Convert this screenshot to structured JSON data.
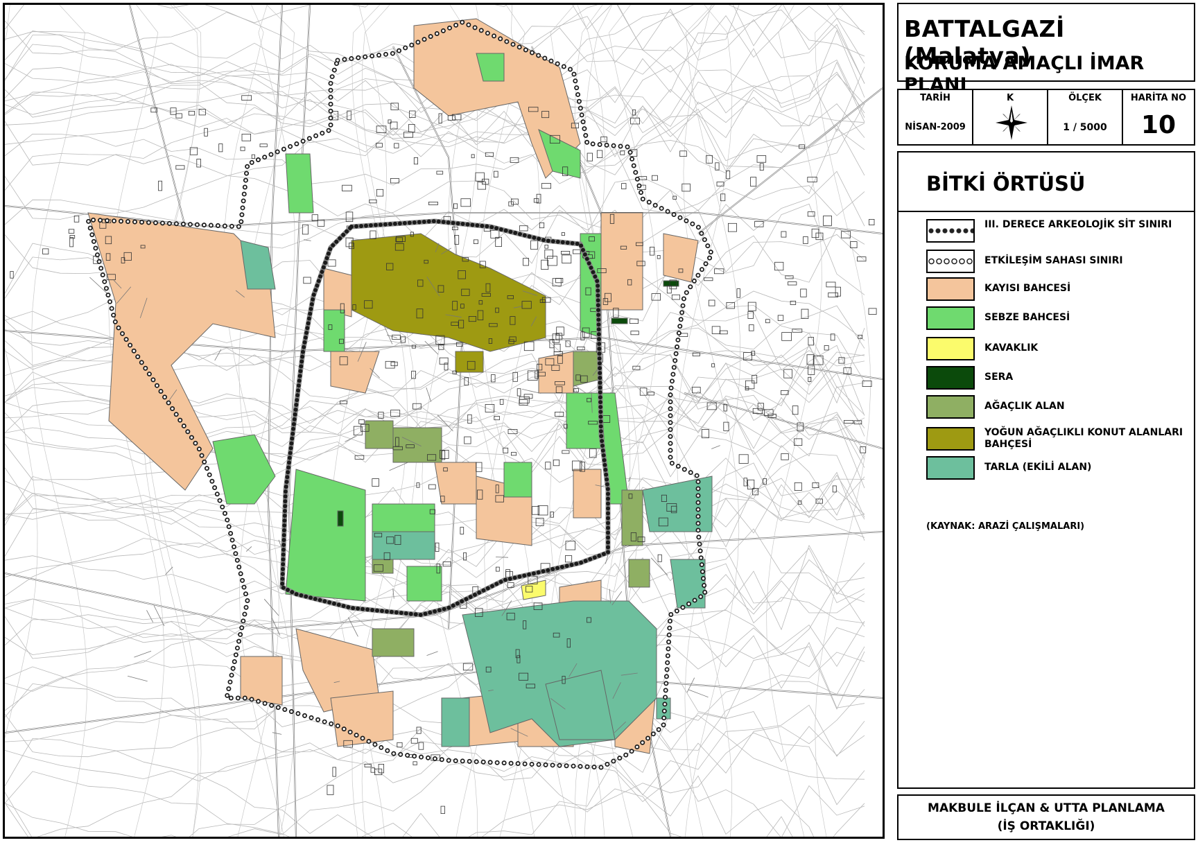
{
  "title": {
    "main": "BATTALGAZİ (Malatya)",
    "sub": "KORUMA AMAÇLI İMAR PLANI"
  },
  "info": {
    "date_label": "TARİH",
    "date_value": "NİSAN-2009",
    "north_label": "K",
    "scale_label": "ÖLÇEK",
    "scale_value": "1 / 5000",
    "map_no_label": "HARİTA NO",
    "map_no_value": "10"
  },
  "legend": {
    "title": "BİTKİ ÖRTÜSÜ",
    "items": [
      {
        "label": "III. DERECE ARKEOLOJİK SİT SINIRI",
        "style": "dots-black",
        "color": "#222222"
      },
      {
        "label": "ETKİLEŞİM SAHASI SINIRI",
        "style": "dots-open",
        "color": "#222222"
      },
      {
        "label": "KAYISI BAHCESİ",
        "style": "fill",
        "color": "#f4c59c"
      },
      {
        "label": "SEBZE BAHCESİ",
        "style": "fill",
        "color": "#6fda6f"
      },
      {
        "label": "KAVAKLIK",
        "style": "fill",
        "color": "#fbfb6c"
      },
      {
        "label": "SERA",
        "style": "fill",
        "color": "#0b4a0b"
      },
      {
        "label": "AĞAÇLIK ALAN",
        "style": "fill",
        "color": "#8faf63"
      },
      {
        "label": "YOĞUN AĞAÇLIKLI KONUT ALANLARI BAHÇESİ",
        "style": "fill",
        "color": "#9e9a12"
      },
      {
        "label": "TARLA (EKİLİ ALAN)",
        "style": "fill",
        "color": "#6dbf9d"
      }
    ],
    "source": "(KAYNAK: ARAZİ ÇALIŞMALARI)"
  },
  "footer": {
    "line1": "MAKBULE İLÇAN & UTTA PLANLAMA",
    "line2": "(İŞ ORTAKLIĞI)"
  },
  "colors": {
    "kayisi": "#f4c59c",
    "sebze": "#6fda6f",
    "kavaklik": "#fbfb6c",
    "sera": "#0b4a0b",
    "agaclik": "#8faf63",
    "yogun": "#9e9a12",
    "tarla": "#6dbf9d",
    "linework": "#555555"
  }
}
